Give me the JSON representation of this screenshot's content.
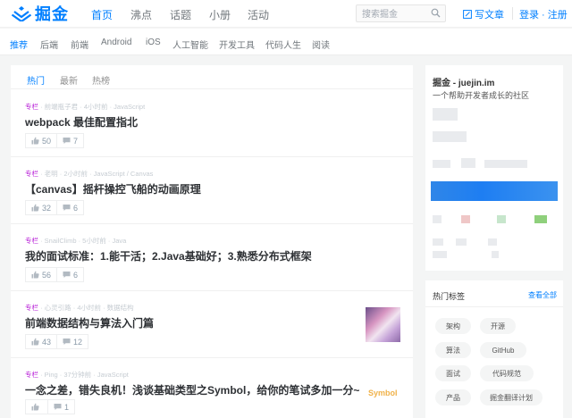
{
  "header": {
    "logo_text": "掘金",
    "nav": [
      "首页",
      "沸点",
      "话题",
      "小册",
      "活动"
    ],
    "search_placeholder": "搜索掘金",
    "write_label": "写文章",
    "auth_label": "登录 · 注册"
  },
  "subnav": [
    "推荐",
    "后端",
    "前端",
    "Android",
    "iOS",
    "人工智能",
    "开发工具",
    "代码人生",
    "阅读"
  ],
  "feed_tabs": [
    "热门",
    "最新",
    "热榜"
  ],
  "entries": [
    {
      "tag": "专栏",
      "meta": " · 前端瓶子君 · 4小时前 · JavaScript",
      "title": "webpack 最佳配置指北",
      "likes": "50",
      "comments": "7"
    },
    {
      "tag": "专栏",
      "meta": " · 老明 · 2小时前 · JavaScript / Canvas",
      "title": "【canvas】摇杆操控飞船的动画原理",
      "likes": "32",
      "comments": "6"
    },
    {
      "tag": "专栏",
      "meta": " · SnailClimb · 5小时前 · Java",
      "title": "我的面试标准：1.能干活；2.Java基础好；3.熟悉分布式框架",
      "likes": "56",
      "comments": "6"
    },
    {
      "tag": "专栏",
      "meta": " · 心灵引路 · 4小时前 · 数据结构",
      "title": "前端数据结构与算法入门篇",
      "likes": "43",
      "comments": "12"
    },
    {
      "tag": "专栏",
      "meta": " · Ping · 37分钟前 · JavaScript",
      "title": "一念之差，错失良机！浅谈基础类型之Symbol，给你的笔试多加一分~",
      "likes": "",
      "comments": "1",
      "thumb_text": "Symbol"
    }
  ],
  "sidebar": {
    "site_title": "掘金 - juejin.im",
    "site_subtitle": "一个帮助开发者成长的社区",
    "tags_title": "热门标签",
    "tags_all": "查看全部",
    "tags": [
      "架构",
      "开源",
      "算法",
      "GitHub",
      "面试",
      "代码规范",
      "产品",
      "掘金翻译计划"
    ]
  },
  "colors": {
    "brand": "#007fff",
    "tag_purple": "#b71ed7"
  }
}
